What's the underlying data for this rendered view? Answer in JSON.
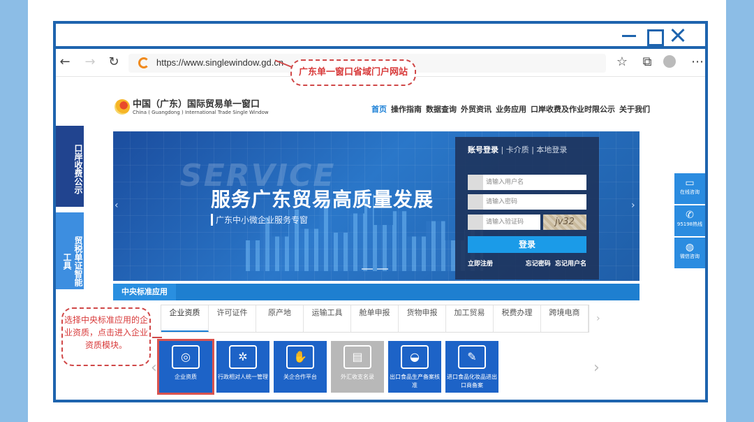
{
  "browser": {
    "url": "https://www.singlewindow.gd.cn",
    "url_callout": "广东单一窗口省域门户网站"
  },
  "site": {
    "logo_cn": "中国（广东）国际贸易单一窗口",
    "logo_en": "China ( Guangdong ) International Trade Single Window",
    "nav": [
      "首页",
      "操作指南",
      "数据查询",
      "外贸资讯",
      "业务应用",
      "口岸收费及作业时限公示",
      "关于我们"
    ]
  },
  "banner": {
    "bg_text": "SERVICE",
    "slogan": "服务广东贸易高质量发展",
    "sub": "广东中小微企业服务专窗"
  },
  "login": {
    "tab_account": "账号登录",
    "tab_card": "卡介质",
    "tab_local": "本地登录",
    "user_placeholder": "请输入用户名",
    "pwd_placeholder": "请输入密码",
    "captcha_placeholder": "请输入验证码",
    "captcha_text": "jv32",
    "button": "登录",
    "register": "立即注册",
    "forgot_pwd": "忘记密码",
    "forgot_user": "忘记用户名"
  },
  "left_float": {
    "box1": "口岸收费公示",
    "box2": "贸税单证智能工具"
  },
  "right_float": [
    "在线咨询",
    "95198热线",
    "微信咨询"
  ],
  "std": {
    "tab": "中央标准应用",
    "categories": [
      "企业资质",
      "许可证件",
      "原产地",
      "运输工具",
      "舱单申报",
      "货物申报",
      "加工贸易",
      "税费办理",
      "跨境电商"
    ],
    "tiles": [
      "企业资质",
      "行政相对人统一管理",
      "关企合作平台",
      "外汇收支名录",
      "出口食品生产备案核准",
      "进口食品化妆品进出口商备案"
    ]
  },
  "callout_main": "选择中央标准应用的企业资质，点击进入企业资质模块。"
}
